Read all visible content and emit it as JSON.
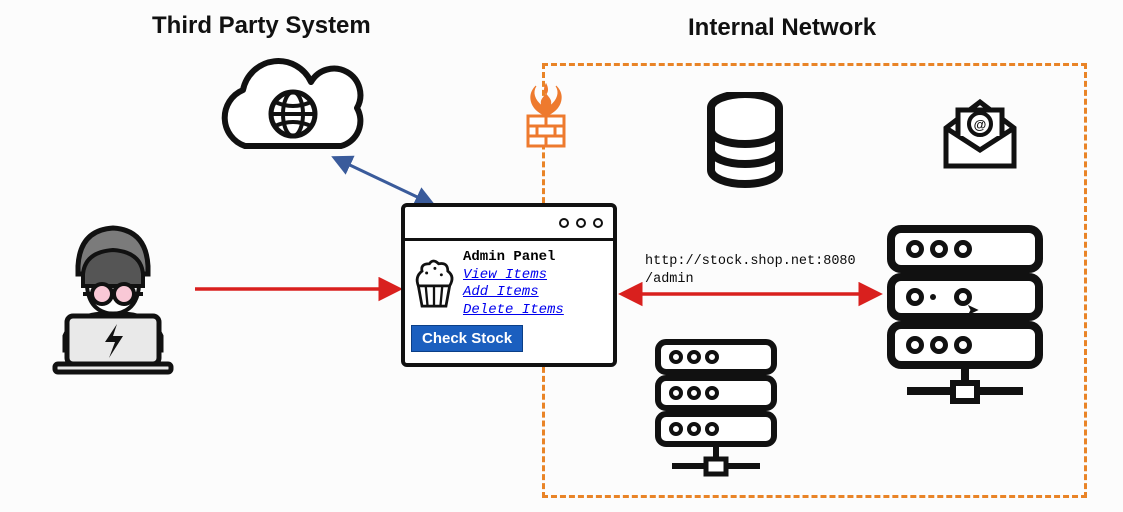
{
  "headings": {
    "third_party": "Third Party System",
    "internal_network": "Internal Network"
  },
  "browser": {
    "admin_title": "Admin Panel",
    "links": {
      "view": "View Items",
      "add": "Add Items",
      "delete": "Delete Items"
    },
    "check_stock_label": "Check Stock"
  },
  "url_label": "http://stock.shop.net:8080\n/admin",
  "colors": {
    "attack_arrow": "#d9201e",
    "third_party_arrow": "#3a5b9b",
    "internal_border": "#e98427",
    "button": "#1b5fbf"
  }
}
